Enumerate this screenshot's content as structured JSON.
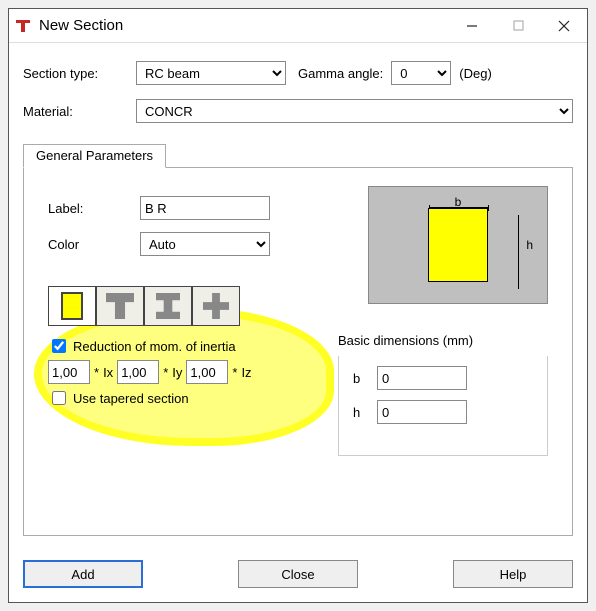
{
  "window": {
    "title": "New Section"
  },
  "form": {
    "section_type_label": "Section type:",
    "section_type_value": "RC beam",
    "gamma_label": "Gamma angle:",
    "gamma_value": "0",
    "gamma_unit": "(Deg)",
    "material_label": "Material:",
    "material_value": "CONCR"
  },
  "tab": {
    "label": "General Parameters"
  },
  "params": {
    "label_text": "Label:",
    "label_value": "B R",
    "color_text": "Color",
    "color_value": "Auto"
  },
  "preview": {
    "b_label": "b",
    "h_label": "h"
  },
  "shapes": {
    "rect": "rectangle",
    "tee": "tee",
    "ibeam": "i-beam",
    "plus": "cross"
  },
  "inertia": {
    "reduction_label": "Reduction of mom. of inertia",
    "ix_val": "1,00",
    "ix_sym": "Ix",
    "iy_val": "1,00",
    "iy_sym": "Iy",
    "iz_val": "1,00",
    "iz_sym": "Iz",
    "star": "*",
    "tapered_label": "Use tapered section"
  },
  "dims": {
    "title": "Basic dimensions (mm)",
    "b_label": "b",
    "b_value": "0",
    "h_label": "h",
    "h_value": "0"
  },
  "buttons": {
    "add": "Add",
    "close": "Close",
    "help": "Help"
  }
}
